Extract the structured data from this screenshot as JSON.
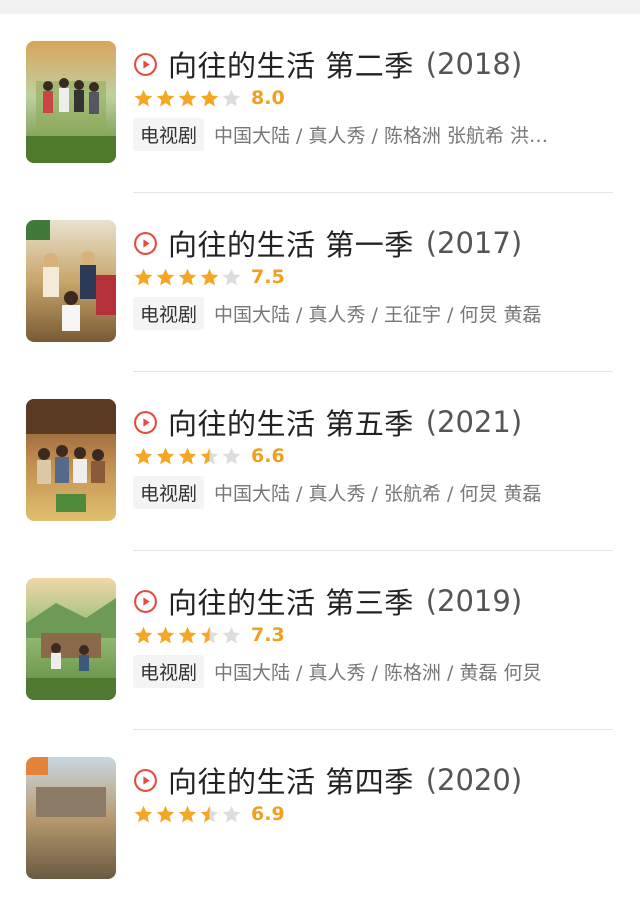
{
  "colors": {
    "accent_red": "#e84a3c",
    "star_gold": "#f5a623",
    "star_gray": "#dddddd",
    "score": "#f0a020"
  },
  "items": [
    {
      "title": "向往的生活 第二季",
      "year": "(2018)",
      "score": "8.0",
      "rating_stars": 4,
      "tag": "电视剧",
      "info": "中国大陆 / 真人秀 / 陈格洲 张航希 洪…",
      "poster_icon": "show-poster-image"
    },
    {
      "title": "向往的生活 第一季",
      "year": "(2017)",
      "score": "7.5",
      "rating_stars": 4,
      "tag": "电视剧",
      "info": "中国大陆 / 真人秀 / 王征宇 / 何炅 黄磊",
      "poster_icon": "show-poster-image"
    },
    {
      "title": "向往的生活 第五季",
      "year": "(2021)",
      "score": "6.6",
      "rating_stars": 3.5,
      "tag": "电视剧",
      "info": "中国大陆 / 真人秀 / 张航希 / 何炅 黄磊",
      "poster_icon": "show-poster-image"
    },
    {
      "title": "向往的生活 第三季",
      "year": "(2019)",
      "score": "7.3",
      "rating_stars": 3.5,
      "tag": "电视剧",
      "info": "中国大陆 / 真人秀 / 陈格洲 / 黄磊 何炅",
      "poster_icon": "show-poster-image"
    },
    {
      "title": "向往的生活 第四季",
      "year": "(2020)",
      "score": "6.9",
      "rating_stars": 3.5,
      "tag": "电视剧",
      "info": "",
      "poster_icon": "show-poster-image"
    }
  ]
}
